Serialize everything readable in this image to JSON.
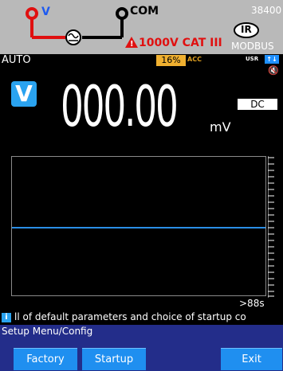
{
  "banner": {
    "input_v": "V",
    "input_com": "COM",
    "warning": "1000V CAT III",
    "model": "38400",
    "ir_label": "IR",
    "modbus": "MODBUS"
  },
  "status": {
    "mode": "AUTO",
    "range": "16%",
    "acc": "ACC",
    "usr": "USR",
    "usr_icon": "↑↓",
    "mute_icon": "speaker-muted-icon"
  },
  "measurement": {
    "function_badge": "V",
    "value": "000.00",
    "unit": "mV",
    "coupling": "DC"
  },
  "graph": {
    "time_label": ">88s"
  },
  "info": {
    "icon": "i",
    "text": "ll of default parameters and choice of startup co"
  },
  "menu": {
    "title": "Setup Menu/Config",
    "softkeys": [
      "Factory",
      "Startup",
      "Exit"
    ]
  },
  "colors": {
    "accent": "#1f8ff0",
    "menu_bg": "#232d8a",
    "range_bg": "#f0b030",
    "warning_red": "#e01010"
  }
}
